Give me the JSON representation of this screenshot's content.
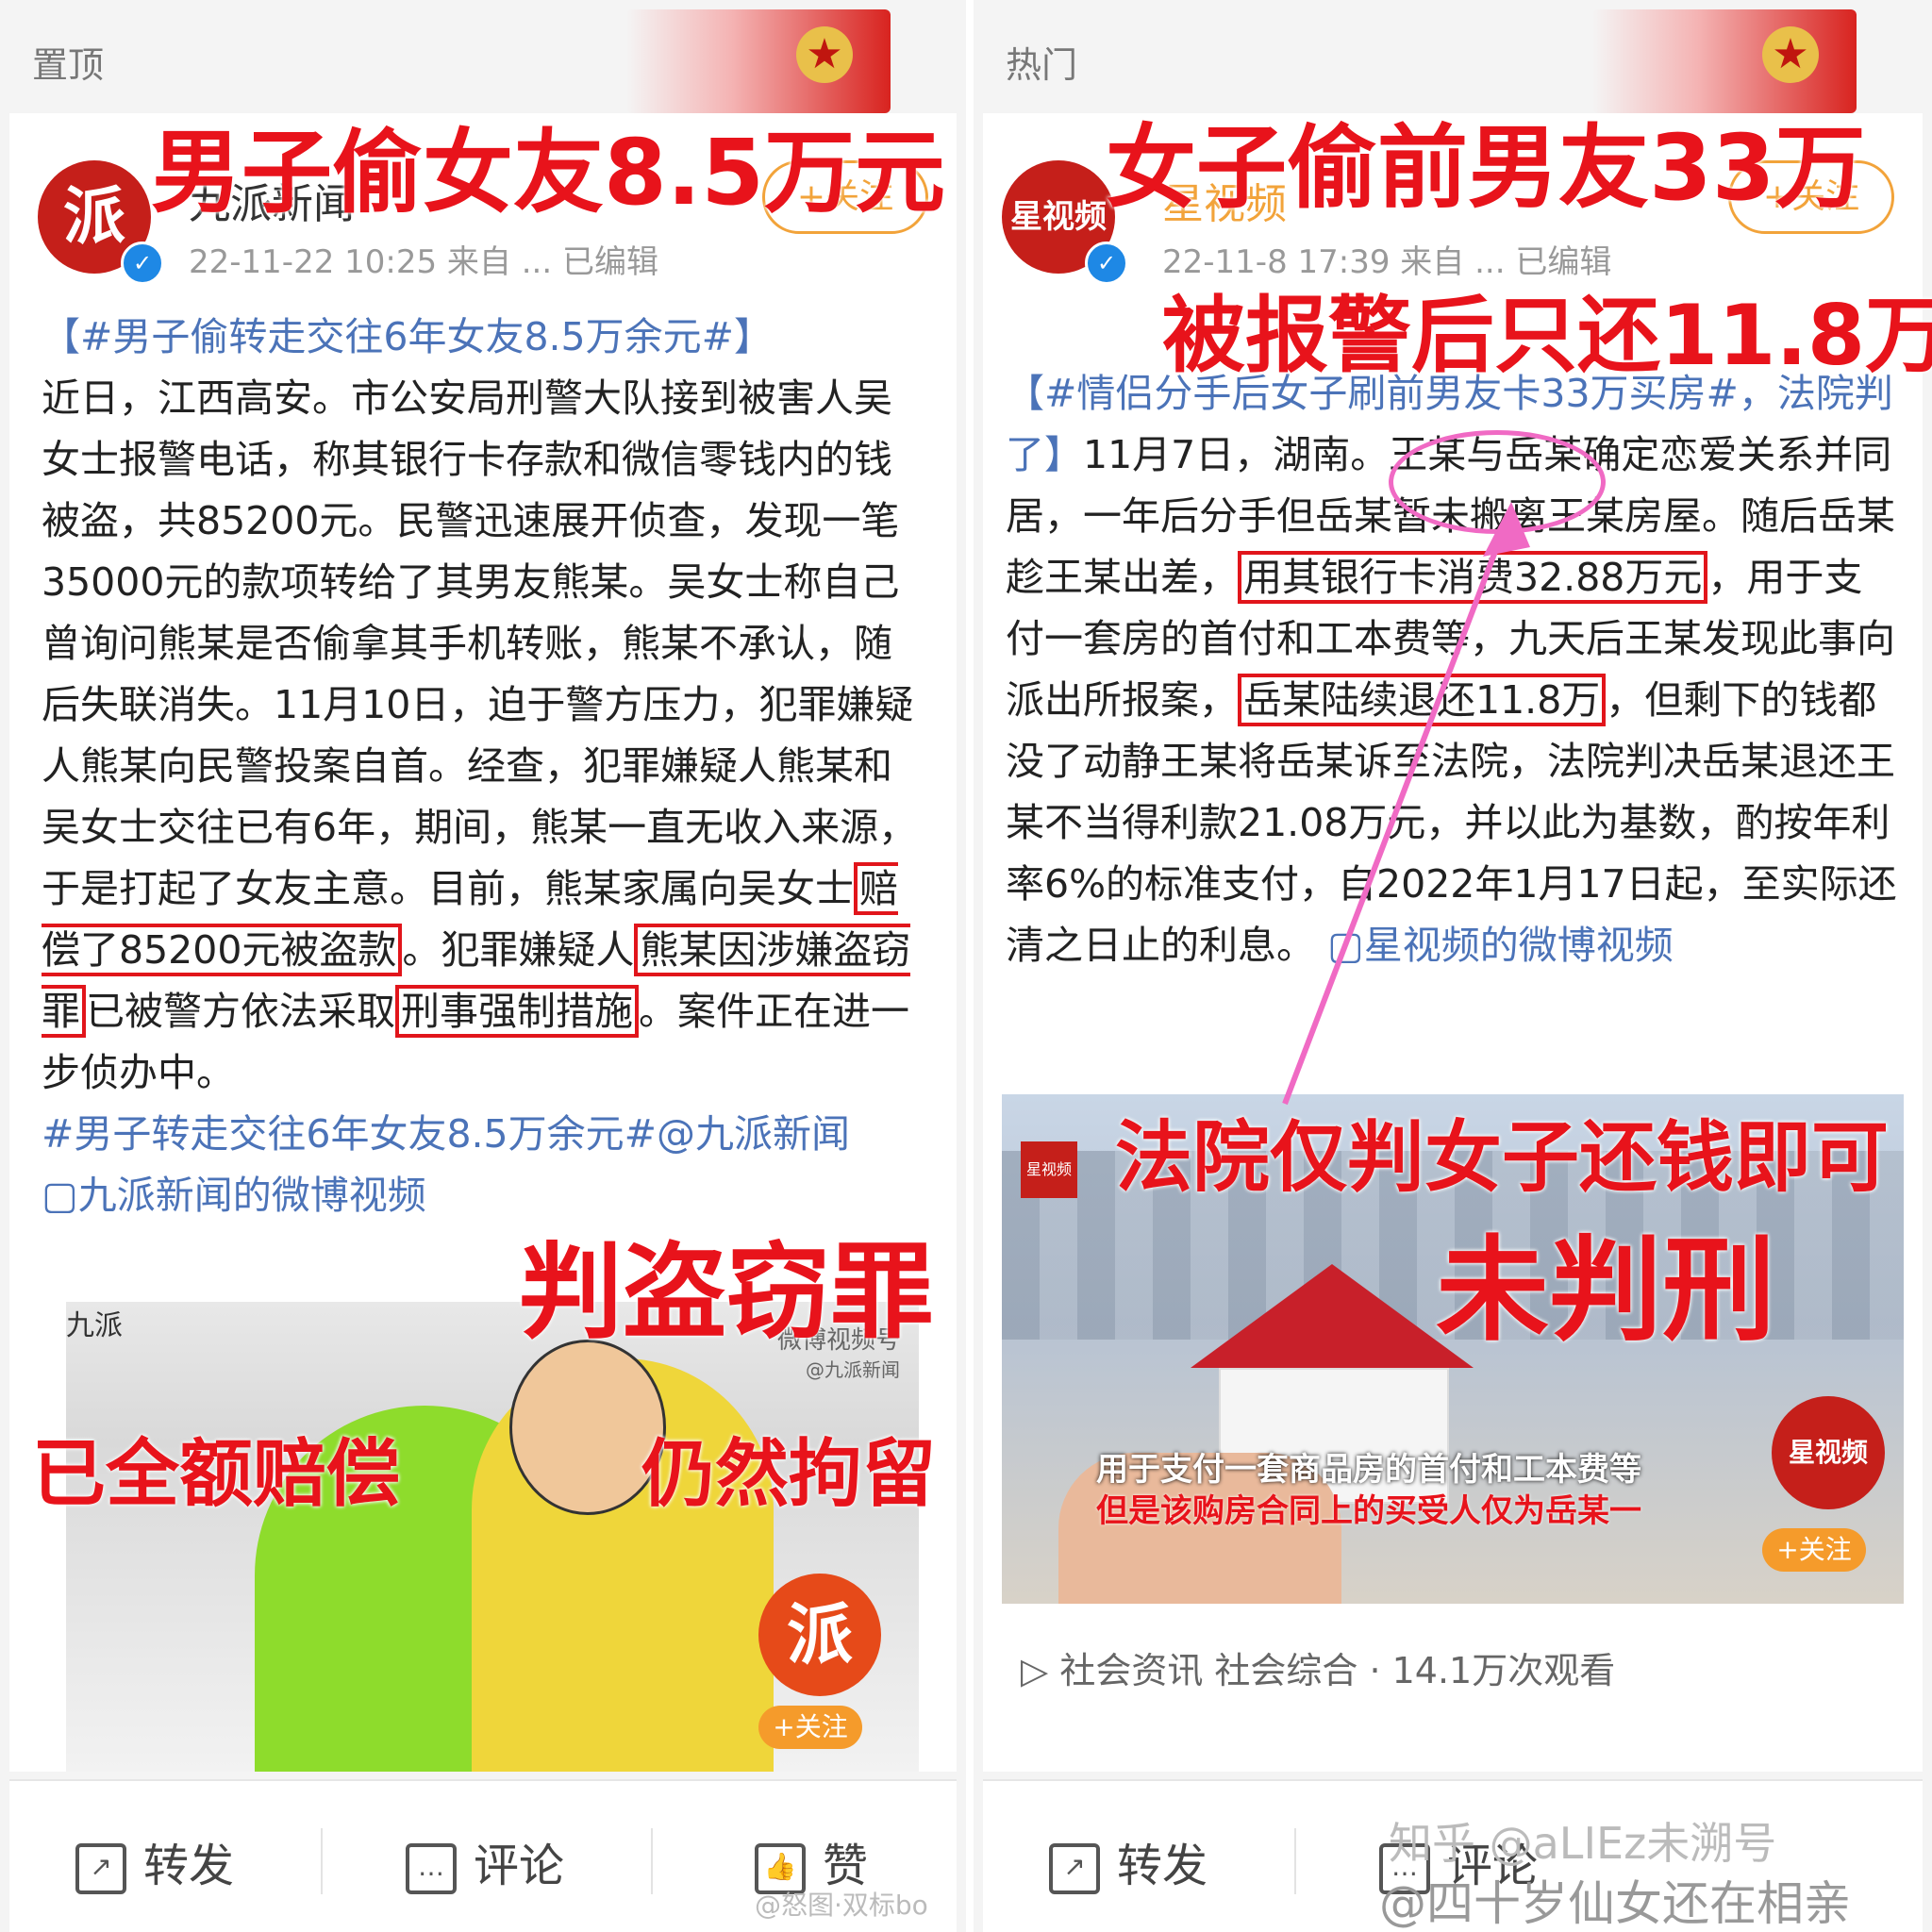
{
  "left": {
    "section_label": "置顶",
    "account": "九派新闻",
    "avatar_glyph": "派",
    "meta": "22-11-22 10:25  来自 ...  已编辑",
    "follow": "+关注",
    "headline_overlay": "男子偷女友8.5万元",
    "title_hashtag": "【#男子偷转走交往6年女友8.5万余元#】",
    "body_1": "近日，江西高安。市公安局刑警大队接到被害人吴女士报警电话，称其银行卡存款和微信零钱内的钱被盗，共85200元。民警迅速展开侦查，发现一笔35000元的款项转给了其男友熊某。吴女士称自己曾询问熊某是否偷拿其手机转账，熊某不承认，随后失联消失。11月10日，迫于警方压力，犯罪嫌疑人熊某向民警投案自首。经查，犯罪嫌疑人熊某和吴女士交往已有6年，期间，熊某一直无收入来源，于是打起了女友主意。目前，熊某家属向吴女士",
    "boxed_1": "赔偿了85200元被盗款",
    "body_2": "。犯罪嫌疑人",
    "boxed_2": "熊某因涉嫌盗窃罪",
    "body_3": "已被警方依法采取",
    "boxed_3": "刑事强制措施",
    "body_4": "。案件正在进一步侦办中。",
    "footer_hashtag": "#男子转走交往6年女友8.5万余元#@九派新闻",
    "video_link": "九派新闻的微博视频",
    "overlay_crime": "判盗窃罪",
    "overlay_paid": "已全额赔偿",
    "overlay_detained": "仍然拘留",
    "image_watermark": "微博视频号",
    "image_watermark_sub": "@九派新闻",
    "image_brand": "九派",
    "image_follow": "+关注",
    "actions": {
      "repost": "转发",
      "comment": "评论",
      "like": "赞"
    },
    "bottom_watermark": "@怒图·双标bo"
  },
  "right": {
    "section_label": "热门",
    "account": "星视频",
    "avatar_glyph": "星视频",
    "meta": "22-11-8 17:39  来自 ...  已编辑",
    "follow": "+关注",
    "headline_overlay": "女子偷前男友33万",
    "subheadline_overlay": "被报警后只还11.8万",
    "title_hashtag": "【#情侣分手后女子刷前男友卡33万买房#，法院判了】",
    "body_1": "11月7日，湖南。王某与岳某确定恋爱关系并同居，一年后分手但岳某暂未搬离王某房屋。随后岳某趁王某出差，",
    "boxed_1": "用其银行卡消费32.88万元",
    "body_2": "，用于支付一套房的首付和工本费等，九天后王某发现此事向派出所报案，",
    "boxed_2": "岳某陆续退还11.8万",
    "body_3": "，但剩下的钱都没了动静王某将岳某诉至法院，法院判决岳某退还王某不当得利款21.08万元，并以此为基数，酌按年利率6%的标准支付，自2022年1月17日起，至实际还清之日止的利息。",
    "video_link": "星视频的微博视频",
    "overlay_court": "法院仅判女子还钱即可",
    "overlay_no_sentence": "未判刑",
    "video_caption_1": "用于支付一套商品房的首付和工本费等",
    "video_caption_2": "但是该购房合同上的买受人仅为岳某一",
    "image_brand": "星视频",
    "image_follow": "+关注",
    "video_stats": "社会资讯 社会综合 · 14.1万次观看",
    "actions": {
      "repost": "转发",
      "comment": "评论"
    },
    "bottom_watermark": "知乎 @aLIEz未溯号",
    "bottom_watermark_2": "@四十岁仙女还在相亲"
  },
  "colors": {
    "accent_red": "#e8131b",
    "link_blue": "#4b73b8",
    "follow_orange": "#f2a33a"
  }
}
